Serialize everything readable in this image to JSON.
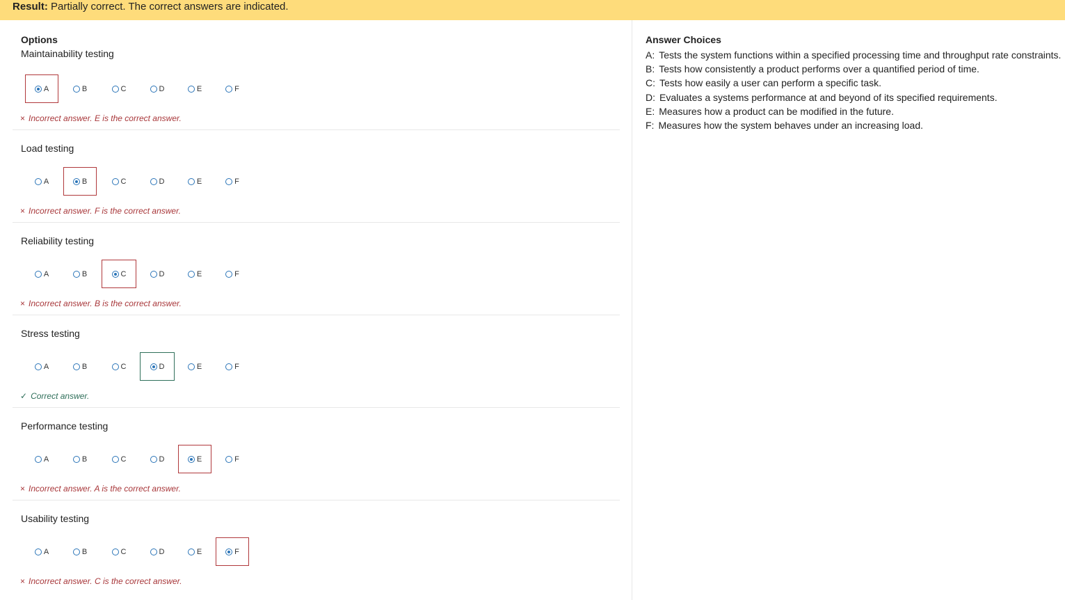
{
  "result": {
    "label": "Result:",
    "text": "Partially correct. The correct answers are indicated."
  },
  "options_heading": "Options",
  "answer_choices_heading": "Answer Choices",
  "choice_letters": [
    "A",
    "B",
    "C",
    "D",
    "E",
    "F"
  ],
  "questions": [
    {
      "title": "Maintainability testing",
      "selected": "A",
      "status": "incorrect",
      "feedback": "Incorrect answer. E is the correct answer."
    },
    {
      "title": "Load testing",
      "selected": "B",
      "status": "incorrect",
      "feedback": "Incorrect answer. F is the correct answer."
    },
    {
      "title": "Reliability testing",
      "selected": "C",
      "status": "incorrect",
      "feedback": "Incorrect answer. B is the correct answer."
    },
    {
      "title": "Stress testing",
      "selected": "D",
      "status": "correct",
      "feedback": "Correct answer."
    },
    {
      "title": "Performance testing",
      "selected": "E",
      "status": "incorrect",
      "feedback": "Incorrect answer. A is the correct answer."
    },
    {
      "title": "Usability testing",
      "selected": "F",
      "status": "incorrect",
      "feedback": "Incorrect answer. C is the correct answer."
    }
  ],
  "answer_choices": [
    {
      "letter": "A:",
      "text": "Tests the system functions within a specified processing time and throughput rate constraints."
    },
    {
      "letter": "B:",
      "text": "Tests how consistently a product performs over a quantified period of time."
    },
    {
      "letter": "C:",
      "text": "Tests how easily a user can perform a specific task."
    },
    {
      "letter": "D:",
      "text": "Evaluates a systems performance at and beyond of its specified requirements."
    },
    {
      "letter": "E:",
      "text": "Measures how a product can be modified in the future."
    },
    {
      "letter": "F:",
      "text": "Measures how the system behaves under an increasing load."
    }
  ],
  "icons": {
    "incorrect": "cross-icon",
    "correct": "check-icon"
  },
  "colors": {
    "result_bar": "#fedc7b",
    "incorrect": "#a8373a",
    "correct": "#2f6f5a",
    "radio": "#2a74b8"
  }
}
